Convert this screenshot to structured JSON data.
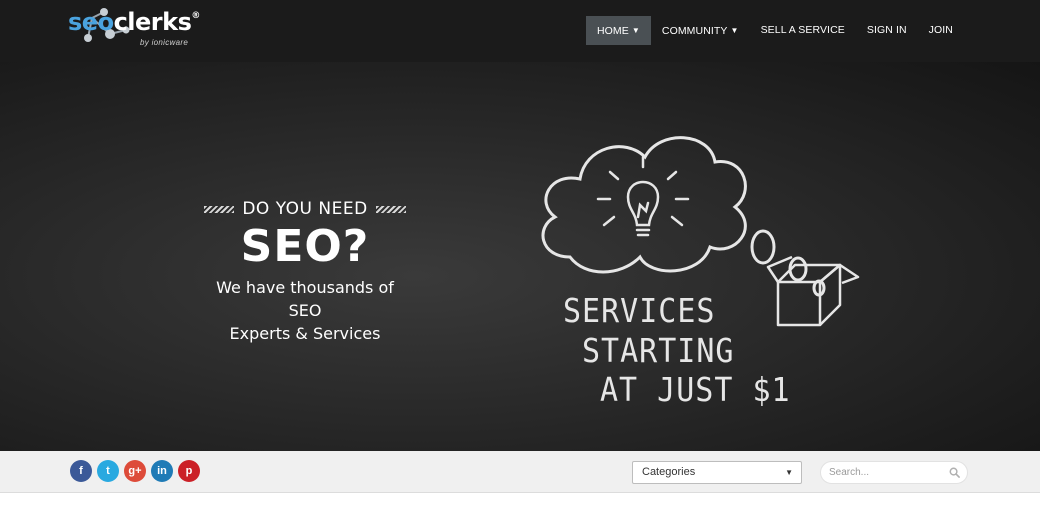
{
  "logo": {
    "seo": "seo",
    "clerks": "clerks",
    "reg": "®",
    "sub": "by ionicware"
  },
  "nav": {
    "home": "HOME",
    "community": "COMMUNITY",
    "sell": "SELL A SERVICE",
    "signin": "SIGN IN",
    "join": "JOIN"
  },
  "hero": {
    "need": "DO YOU NEED",
    "seo": "SEO?",
    "tagline_1": "We have thousands of SEO",
    "tagline_2": "Experts & Services",
    "chalk_1": "SERVICES",
    "chalk_2": "STARTING",
    "chalk_3": "AT JUST $1"
  },
  "social": {
    "facebook": "f",
    "twitter": "t",
    "googleplus": "g+",
    "linkedin": "in",
    "pinterest": "p"
  },
  "categories": {
    "selected": "Categories"
  },
  "search": {
    "placeholder": "Search..."
  },
  "colors": {
    "header_bg": "#1b1b1b",
    "logo_blue": "#4aa3df",
    "nav_active": "#4a5054",
    "facebook": "#3b5998",
    "twitter": "#29a9e0",
    "googleplus": "#dd4b39",
    "linkedin": "#1f7bb6",
    "pinterest": "#cb2027"
  }
}
